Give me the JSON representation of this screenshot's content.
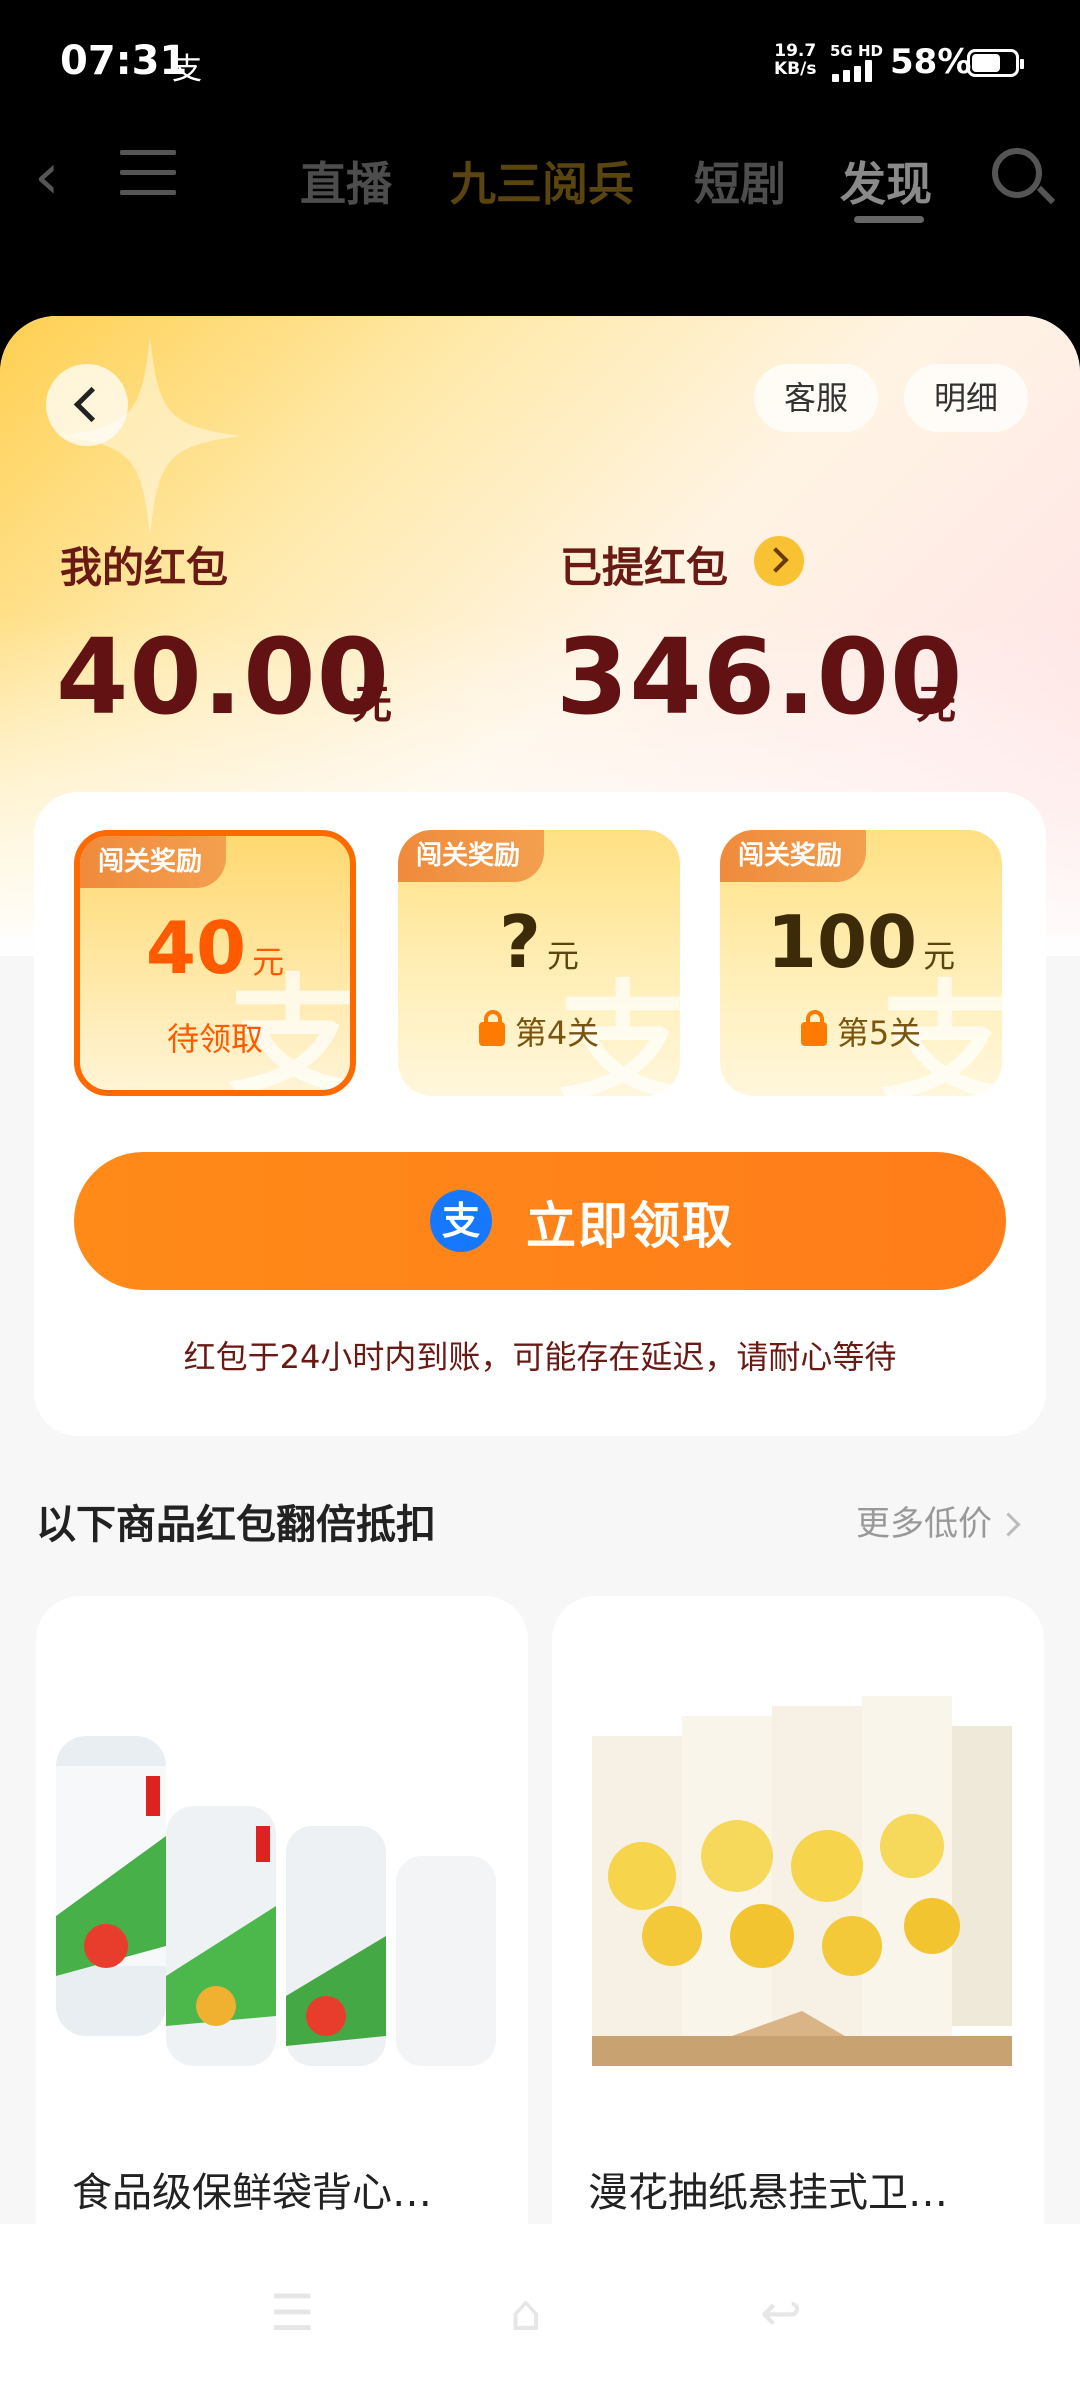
{
  "status_bar": {
    "time": "07:31",
    "alipay_glyph": "支",
    "net_speed_value": "19.7",
    "net_speed_unit": "KB/s",
    "signal_label": "5G HD",
    "battery": "58%"
  },
  "background_nav": {
    "tabs": [
      "直播",
      "九三阅兵",
      "短剧",
      "发现"
    ],
    "active_tab": "发现"
  },
  "header": {
    "service_label": "客服",
    "detail_label": "明细"
  },
  "balance": {
    "my_label": "我的红包",
    "my_amount": "40.00",
    "withdrawn_label": "已提红包",
    "withdrawn_amount": "346.00",
    "unit": "元"
  },
  "rewards": {
    "tiles": [
      {
        "tag": "闯关奖励",
        "amount": "40",
        "unit": "元",
        "status": "待领取",
        "locked": false,
        "watermark": "支"
      },
      {
        "tag": "闯关奖励",
        "amount": "?",
        "unit": "元",
        "status": "第4关",
        "locked": true,
        "watermark": "支"
      },
      {
        "tag": "闯关奖励",
        "amount": "100",
        "unit": "元",
        "status": "第5关",
        "locked": true,
        "watermark": "支"
      }
    ],
    "claim_icon": "支",
    "claim_label": "立即领取",
    "notice": "红包于24小时内到账，可能存在延迟，请耐心等待"
  },
  "products_section": {
    "title": "以下商品红包翻倍抵扣",
    "more_label": "更多低价",
    "items": [
      {
        "name": "食品级保鲜袋背心…"
      },
      {
        "name": "漫花抽纸悬挂式卫…"
      }
    ]
  },
  "colors": {
    "accent": "#ff7d1a",
    "amount_dark": "#621212",
    "alipay_blue": "#1677ff"
  }
}
